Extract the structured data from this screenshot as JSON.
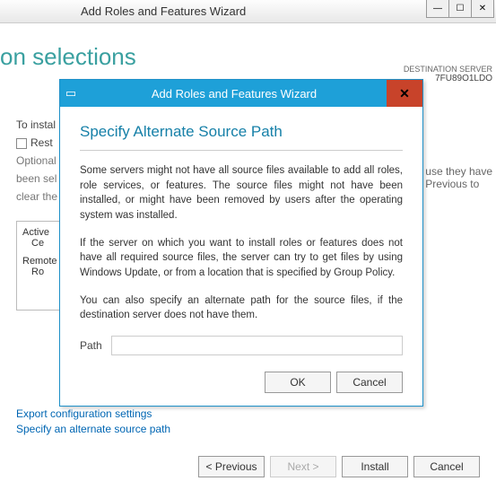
{
  "outer": {
    "title": "Add Roles and Features Wizard",
    "page_heading_fragment": "on selections",
    "dest_label": "DESTINATION SERVER",
    "dest_value": "7FU89O1LDO",
    "to_install": "To instal",
    "restart_frag": "Rest",
    "optional_l1": "Optional",
    "optional_l2": "been sel",
    "optional_l3": "clear the",
    "right_frag1": "use they have",
    "right_frag2": "Previous to",
    "box_l1": "Active",
    "box_l2": "Ce",
    "box_l3": "Remote",
    "box_l4": "Ro",
    "link1": "Export configuration settings",
    "link2": "Specify an alternate source path",
    "btn_prev": "< Previous",
    "btn_next": "Next >",
    "btn_install": "Install",
    "btn_cancel": "Cancel"
  },
  "modal": {
    "title": "Add Roles and Features Wizard",
    "heading": "Specify Alternate Source Path",
    "para1": "Some servers might not have all source files available to add all roles, role services, or features. The source files might not have been installed, or might have been removed by users after the operating system was installed.",
    "para2": "If the server on which you want to install roles or features does not have all required source files, the server can try to get files by using Windows Update, or from a location that is specified by Group Policy.",
    "para3": "You can also specify an alternate path for the source files, if the destination server does not have them.",
    "path_label": "Path",
    "path_value": "",
    "ok": "OK",
    "cancel": "Cancel"
  }
}
